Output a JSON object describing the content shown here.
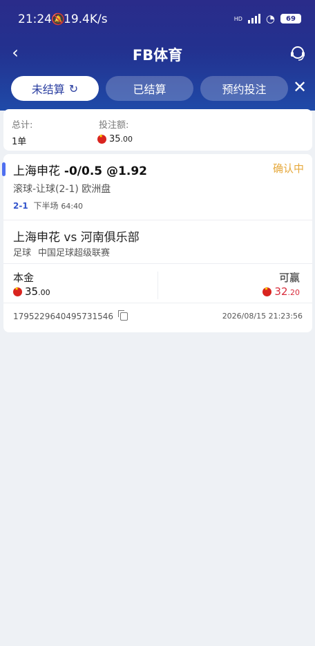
{
  "status_bar": {
    "time": "21:24",
    "net_speed": "19.4K/s",
    "network": "HD",
    "battery": "69"
  },
  "nav": {
    "title": "FB体育"
  },
  "tabs": [
    {
      "label": "未结算",
      "active": true
    },
    {
      "label": "已结算",
      "active": false
    },
    {
      "label": "预约投注",
      "active": false
    }
  ],
  "summary": {
    "total_label": "总计:",
    "total_value": "1单",
    "stake_label": "投注额:",
    "stake_int": "35",
    "stake_dec": ".00"
  },
  "bet": {
    "team": "上海申花",
    "handicap": "-0/0.5 @1.92",
    "status": "确认中",
    "market": "滚球-让球(2-1) 欧洲盘",
    "live_score": "2-1",
    "live_period": "下半场",
    "live_clock": "64:40",
    "match": "上海申花 vs 河南俱乐部",
    "sport": "足球",
    "league": "中国足球超级联赛",
    "stake_label": "本金",
    "stake_int": "35",
    "stake_dec": ".00",
    "win_label": "可赢",
    "win_int": "32",
    "win_dec": ".20",
    "order_id": "1795229640495731546",
    "placed_at": "2026/08/15 21:23:56"
  },
  "colors": {
    "header_top": "#2a2c8a",
    "header_bottom": "#1f4aa8",
    "status_pending": "#e6a93c",
    "win_amount": "#d82c3c",
    "accent": "#4f6ff0"
  }
}
